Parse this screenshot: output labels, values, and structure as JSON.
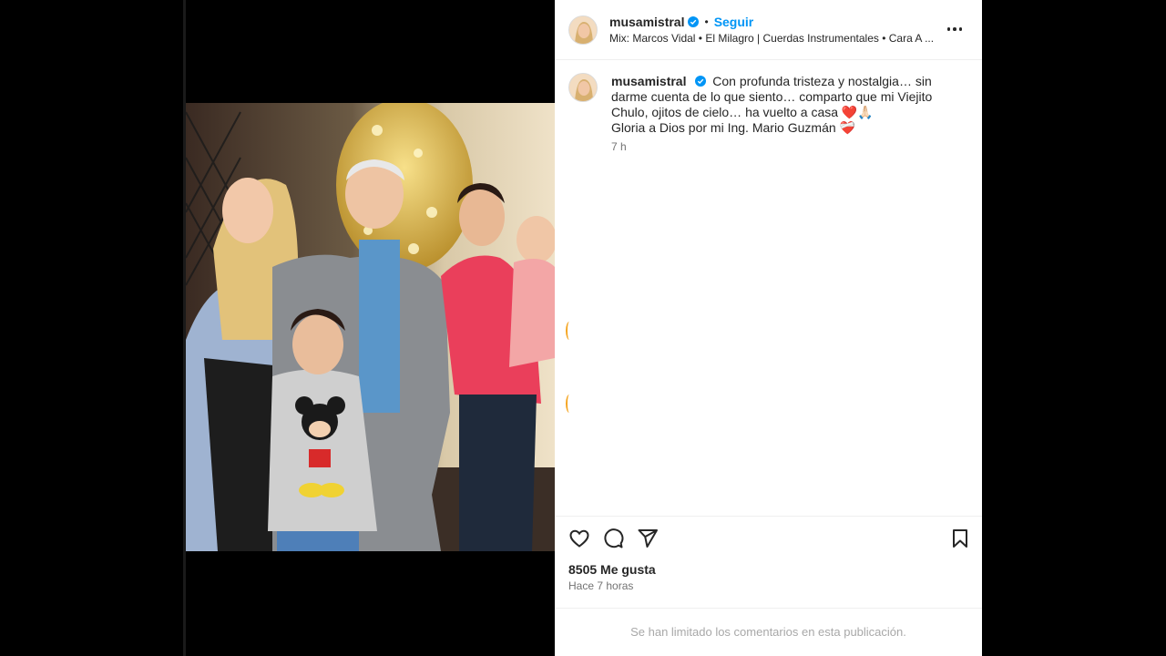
{
  "header": {
    "username": "musamistral",
    "separator": "•",
    "follow_label": "Seguir",
    "audio_line": "Mix: Marcos Vidal • El Milagro | Cuerdas Instrumentales • Cara A ...",
    "more_icon": "more-horizontal-icon"
  },
  "caption": {
    "username": "musamistral",
    "text_line1": "Con profunda tristeza y nostalgia… sin darme cuenta de lo que siento… comparto que mi Viejito Chulo, ojitos de cielo… ha vuelto a casa ❤️🙏🏻",
    "text_line2": "Gloria a Dios por mi Ing. Mario Guzmán ❤️‍🩹",
    "time": "7 h"
  },
  "actions": {
    "like_icon": "heart-icon",
    "comment_icon": "comment-icon",
    "share_icon": "send-icon",
    "save_icon": "bookmark-icon"
  },
  "stats": {
    "likes": "8505 Me gusta",
    "posted_ago": "Hace 7 horas"
  },
  "comments_notice": "Se han limitado los comentarios en esta publicación.",
  "media": {
    "mute_icon": "speaker-muted-icon"
  },
  "colors": {
    "accent": "#0095f6",
    "verified": "#0095f6",
    "like_red": "#ed4956"
  }
}
